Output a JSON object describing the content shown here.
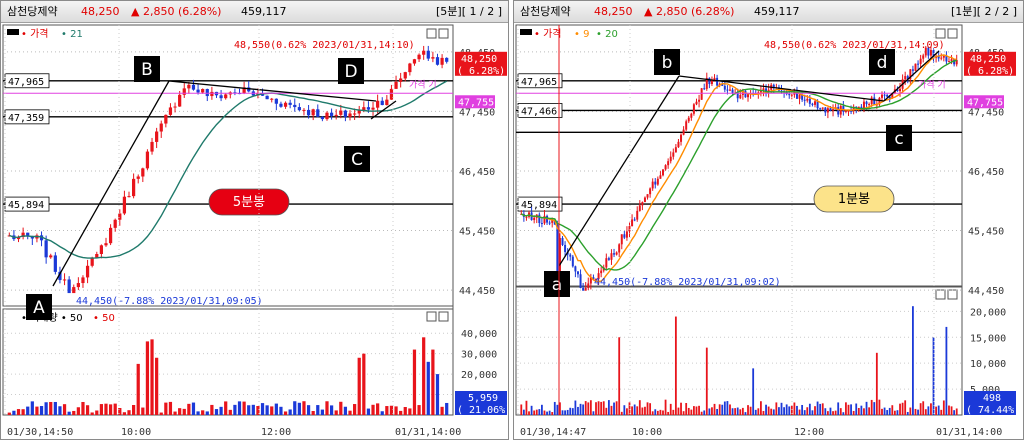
{
  "panels": [
    {
      "id": "left",
      "title": {
        "name": "삼천당제약",
        "price": "48,250",
        "change": "▲ 2,850 (6.28%)",
        "volume": "459,117",
        "timeframe": "[5분][ 1 / 2 ]"
      },
      "legend": {
        "price_label": "가격",
        "ma_label": "21",
        "volume_label": "거래량",
        "vol_ma1": "50",
        "vol_ma2": "50"
      },
      "badge": {
        "label": "5분봉",
        "bg": "#e60012",
        "fg": "#ffffff"
      },
      "markers": [
        "A",
        "B",
        "C",
        "D"
      ],
      "h_levels": [
        "47,965",
        "47,359",
        "45,894"
      ],
      "high_note": "48,550(0.62% 2023/01/31,14:10)",
      "low_note": "44,450(-7.88% 2023/01/31,09:05)",
      "current_price_tag": [
        "48,250",
        "( 6.28%)"
      ],
      "ma_tag": "47,755",
      "ma_text": "가격 기",
      "price_axis": [
        "48,450",
        "47,450",
        "46,450",
        "45,450",
        "44,450"
      ],
      "volume_axis": [
        "40,000",
        "30,000",
        "20,000",
        "10,000"
      ],
      "volume_tag": [
        "5,959",
        "( 21.06%)"
      ],
      "time_axis": [
        "01/30,14:50",
        "10:00",
        "12:00",
        "01/31,14:00"
      ]
    },
    {
      "id": "right",
      "title": {
        "name": "삼천당제약",
        "price": "48,250",
        "change": "▲ 2,850 (6.28%)",
        "volume": "459,117",
        "timeframe": "[1분][ 2 / 2 ]"
      },
      "legend": {
        "price_label": "가격",
        "ma_label": "9",
        "ma2_label": "20"
      },
      "badge": {
        "label": "1분봉",
        "bg": "#fce38a",
        "fg": "#000000"
      },
      "markers": [
        "a",
        "b",
        "c",
        "d"
      ],
      "h_levels": [
        "47,965",
        "47,466",
        "45,894"
      ],
      "high_note": "48,550(0.62% 2023/01/31,14:09)",
      "low_note": "44,450(-7.88% 2023/01/31,09:02)",
      "current_price_tag": [
        "48,250",
        "( 6.28%)"
      ],
      "ma_tag": "47,755",
      "ma_text": "가격 기",
      "price_axis": [
        "48,450",
        "47,450",
        "46,450",
        "45,450",
        "44,450"
      ],
      "volume_axis": [
        "20,000",
        "15,000",
        "10,000",
        "5,000"
      ],
      "volume_tag": [
        "498",
        "( 74.44%)"
      ],
      "time_axis": [
        "01/30,14:47",
        "10:00",
        "12:00",
        "01/31,14:00"
      ]
    }
  ],
  "chart_data": [
    {
      "type": "candlestick",
      "title": "삼천당제약 5분봉",
      "series": [
        {
          "name": "가격",
          "x": [
            "01/30,14:50",
            "10:00",
            "12:00",
            "01/31,14:00"
          ],
          "close_path": [
            45350,
            45300,
            44450,
            45000,
            46000,
            47000,
            47900,
            47700,
            47800,
            47650,
            47500,
            47350,
            47450,
            47700,
            48450,
            48250
          ]
        },
        {
          "name": "MA21"
        }
      ],
      "ylim": [
        44300,
        48700
      ],
      "high": 48550,
      "low": 44450,
      "last": 48250,
      "levels": [
        47965,
        47359,
        45894
      ],
      "volume": {
        "ylim": [
          0,
          45000
        ],
        "max_bar": 37000,
        "last": 5959
      }
    },
    {
      "type": "candlestick",
      "title": "삼천당제약 1분봉",
      "series": [
        {
          "name": "가격",
          "x": [
            "01/30,14:47",
            "10:00",
            "12:00",
            "01/31,14:00"
          ],
          "close_path": [
            45700,
            45600,
            44450,
            45100,
            46000,
            46900,
            48000,
            47700,
            47850,
            47700,
            47450,
            47560,
            47750,
            48450,
            48250
          ]
        },
        {
          "name": "MA9"
        },
        {
          "name": "MA20"
        }
      ],
      "ylim": [
        44300,
        48700
      ],
      "high": 48550,
      "low": 44450,
      "last": 48250,
      "levels": [
        47965,
        47466,
        45894
      ],
      "volume": {
        "ylim": [
          0,
          22000
        ],
        "max_bar": 21000,
        "last": 498
      }
    }
  ]
}
